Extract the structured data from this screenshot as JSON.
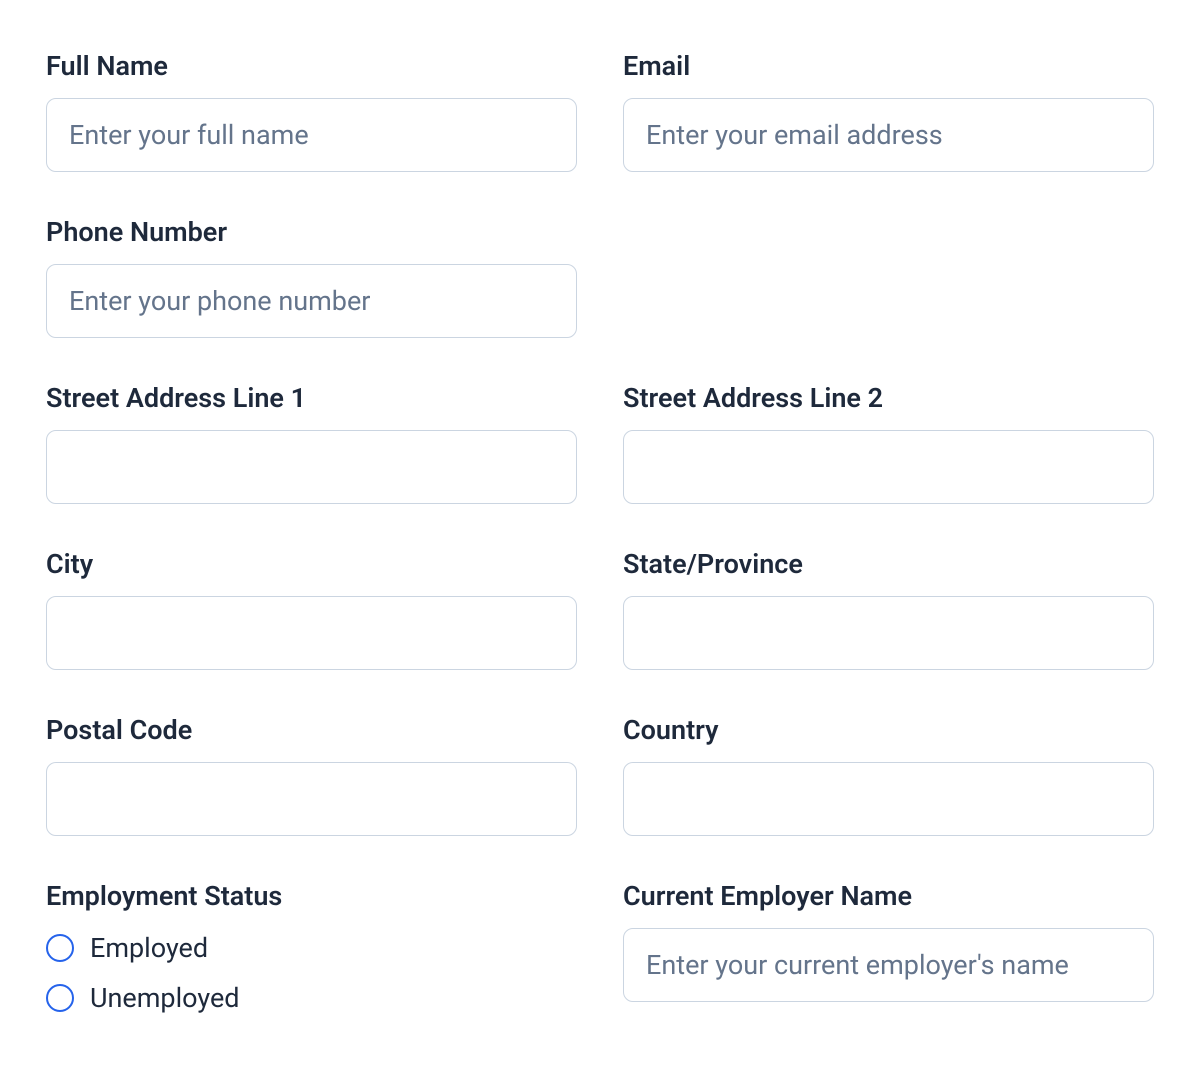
{
  "fields": {
    "full_name": {
      "label": "Full Name",
      "placeholder": "Enter your full name"
    },
    "email": {
      "label": "Email",
      "placeholder": "Enter your email address"
    },
    "phone": {
      "label": "Phone Number",
      "placeholder": "Enter your phone number"
    },
    "street1": {
      "label": "Street Address Line 1",
      "placeholder": ""
    },
    "street2": {
      "label": "Street Address Line 2",
      "placeholder": ""
    },
    "city": {
      "label": "City",
      "placeholder": ""
    },
    "state": {
      "label": "State/Province",
      "placeholder": ""
    },
    "postal": {
      "label": "Postal Code",
      "placeholder": ""
    },
    "country": {
      "label": "Country",
      "placeholder": ""
    },
    "employment_status": {
      "label": "Employment Status",
      "options": [
        "Employed",
        "Unemployed"
      ]
    },
    "employer_name": {
      "label": "Current Employer Name",
      "placeholder": "Enter your current employer's name"
    }
  }
}
